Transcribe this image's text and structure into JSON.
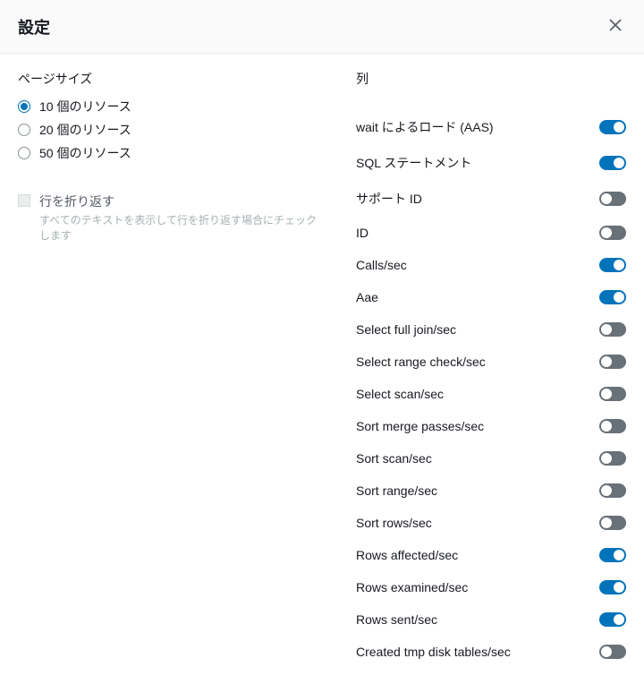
{
  "header": {
    "title": "設定"
  },
  "pageSize": {
    "title": "ページサイズ",
    "options": [
      {
        "label": "10 個のリソース",
        "value": 10,
        "selected": true
      },
      {
        "label": "20 個のリソース",
        "value": 20,
        "selected": false
      },
      {
        "label": "50 個のリソース",
        "value": 50,
        "selected": false
      }
    ]
  },
  "wrapLines": {
    "label": "行を折り返す",
    "description": "すべてのテキストを表示して行を折り返す場合にチェックします",
    "checked": false
  },
  "columns": {
    "title": "列",
    "items": [
      {
        "label": "wait によるロード (AAS)",
        "enabled": true
      },
      {
        "label": "SQL ステートメント",
        "enabled": true
      },
      {
        "label": "サポート ID",
        "enabled": false
      },
      {
        "label": "ID",
        "enabled": false
      },
      {
        "label": "Calls/sec",
        "enabled": true
      },
      {
        "label": "Aae",
        "enabled": true
      },
      {
        "label": "Select full join/sec",
        "enabled": false
      },
      {
        "label": "Select range check/sec",
        "enabled": false
      },
      {
        "label": "Select scan/sec",
        "enabled": false
      },
      {
        "label": "Sort merge passes/sec",
        "enabled": false
      },
      {
        "label": "Sort scan/sec",
        "enabled": false
      },
      {
        "label": "Sort range/sec",
        "enabled": false
      },
      {
        "label": "Sort rows/sec",
        "enabled": false
      },
      {
        "label": "Rows affected/sec",
        "enabled": true
      },
      {
        "label": "Rows examined/sec",
        "enabled": true
      },
      {
        "label": "Rows sent/sec",
        "enabled": true
      },
      {
        "label": "Created tmp disk tables/sec",
        "enabled": false
      }
    ]
  }
}
